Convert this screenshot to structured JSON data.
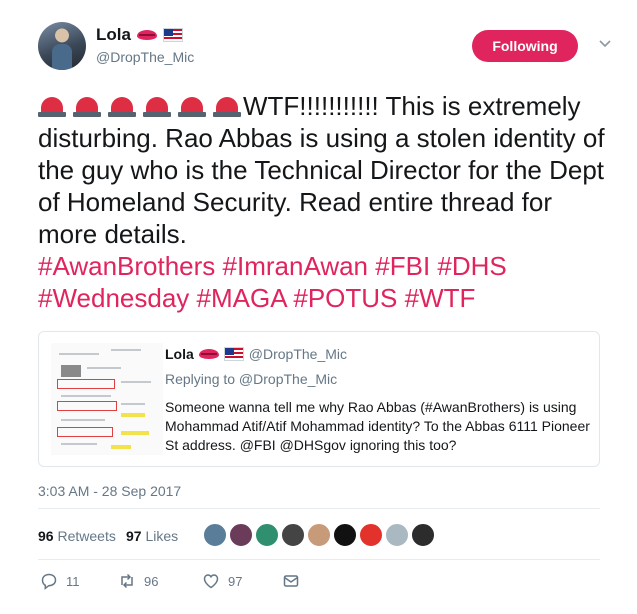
{
  "author": {
    "name": "Lola",
    "handle": "@DropThe_Mic",
    "badges": [
      "kiss-mark-emoji",
      "us-flag-emoji"
    ]
  },
  "follow_button": {
    "label": "Following",
    "color": "#e0245e"
  },
  "tweet": {
    "siren_emoji_count": 6,
    "text_part": "WTF!!!!!!!!!!! This is extremely disturbing. Rao Abbas is using a stolen identity of the guy who is the Technical Director for the Dept of Homeland Security. Read entire thread for more details.",
    "hashtags": [
      "#AwanBrothers",
      "#ImranAwan",
      "#FBI",
      "#DHS",
      "#Wednesday",
      "#MAGA",
      "#POTUS",
      "#WTF"
    ]
  },
  "quoted_tweet": {
    "name": "Lola",
    "handle": "@DropThe_Mic",
    "replying_to": "Replying to @DropThe_Mic",
    "text": "Someone wanna tell me why Rao Abbas (#AwanBrothers) is using Mohammad Atif/Atif Mohammad identity? To the Abbas 6111 Pioneer St address. @FBI @DHSgov ignoring this too?"
  },
  "timestamp": "3:03 AM - 28 Sep 2017",
  "stats": {
    "retweets_count": "96",
    "retweets_label": "Retweets",
    "likes_count": "97",
    "likes_label": "Likes",
    "liker_avatar_colors": [
      "#5a7d9a",
      "#6b3b5a",
      "#2f8f6f",
      "#444444",
      "#c79a7a",
      "#111111",
      "#e3322b",
      "#aab8c2",
      "#2c2c2c"
    ]
  },
  "actions": {
    "reply_count": "11",
    "retweet_count": "96",
    "like_count": "97"
  },
  "colors": {
    "accent": "#e0245e",
    "muted": "#657786",
    "text": "#14171a"
  }
}
